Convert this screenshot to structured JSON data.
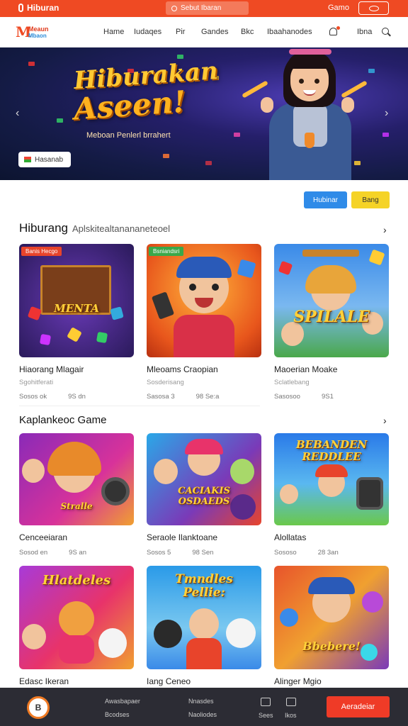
{
  "topbar": {
    "brand": "Hiburan",
    "search_placeholder": "Sebut Ibaran",
    "login": "Gamo",
    "bg_color": "#ef4a23"
  },
  "nav": {
    "logo_line1": "Meaun",
    "logo_line2": "Mbaon",
    "links": [
      "Hame",
      "Iudaqes",
      "Pir",
      "Gandes",
      "Bkc",
      "Ibaahanodes",
      "Ibna"
    ],
    "icons": [
      "bell-icon",
      "search-icon"
    ]
  },
  "hero": {
    "title_line1": "Hiburakan",
    "title_line2": "Aseen!",
    "subtitle": "Meboan Penlerl brrahert",
    "chip_label": "Hasanab",
    "prev_icon": "chevron-left-icon",
    "next_icon": "chevron-right-icon"
  },
  "actions": {
    "blue_button": "Hubinar",
    "yellow_button": "Bang"
  },
  "section1": {
    "title": "Hiburang",
    "subtitle": "Aplskitealtanananeteoel",
    "cards": [
      {
        "tag": "Banis Hecgo",
        "tag_color": "#e8442b",
        "title": "Hiaorang Mlagair",
        "sub": "Sgohitferati",
        "meta1": "Sosos ok",
        "meta2": "9S dn",
        "art": "MENTA"
      },
      {
        "tag": "Bsniandsri",
        "tag_color": "#3aa84a",
        "title": "Mleoams Craopian",
        "sub": "Sosderisang",
        "meta1": "Sasosa 3",
        "meta2": "98 Se:a",
        "art": ""
      },
      {
        "tag": "",
        "tag_color": "",
        "title": "Maoerian Moake",
        "sub": "Sclatlebang",
        "meta1": "Sasosoo",
        "meta2": "9S1",
        "art": "SPILALE"
      }
    ]
  },
  "section2": {
    "title": "Kaplankeoc Game",
    "cards": [
      {
        "title": "Cenceeiaran",
        "meta1": "Sosod en",
        "meta2": "9S an",
        "art": "Stralle"
      },
      {
        "title": "Seraole Ilanktoane",
        "meta1": "Sosos 5",
        "meta2": "98 Sen",
        "art": "CACIAKIS OSDAEDS"
      },
      {
        "title": "Alollatas",
        "meta1": "Sososo",
        "meta2": "28 3an",
        "art": "BEBANDEN REDDLEE"
      }
    ]
  },
  "section3": {
    "cards": [
      {
        "title": "Edasc Ikeran",
        "art": "Hlatdeles"
      },
      {
        "title": "Iang Ceneo",
        "art": "Tmndles Pellie:"
      },
      {
        "title": "Alinger Mgio",
        "art": "Bbebere!"
      }
    ]
  },
  "bottombar": {
    "logo": "B",
    "link1a": "Awasbapaer",
    "link1b": "Bcodses",
    "link2a": "Nnasdes",
    "link2b": "Naoliodes",
    "icon1_label": "Sees",
    "icon2_label": "Ikos",
    "cta": "Aeradeiar"
  }
}
